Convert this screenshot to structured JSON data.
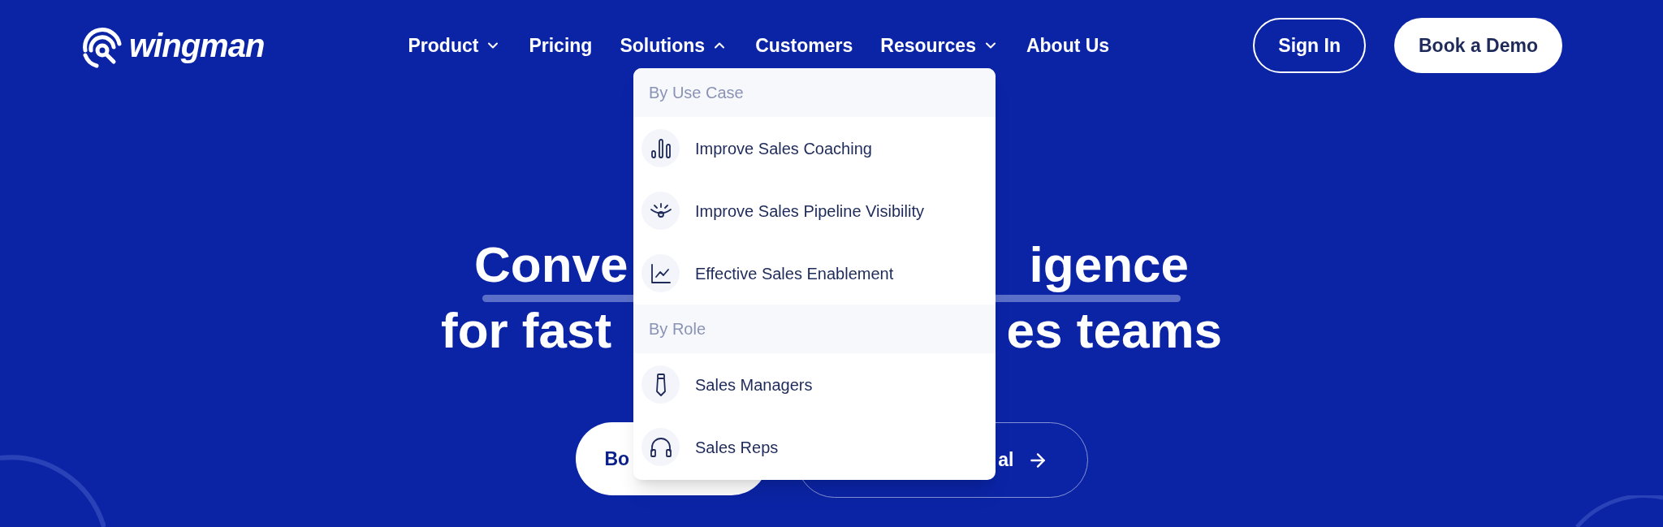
{
  "logo": {
    "text": "wingman"
  },
  "nav": [
    {
      "label": "Product",
      "expanded": false
    },
    {
      "label": "Pricing"
    },
    {
      "label": "Solutions",
      "expanded": true
    },
    {
      "label": "Customers"
    },
    {
      "label": "Resources",
      "expanded": false
    },
    {
      "label": "About Us"
    }
  ],
  "actions": [
    {
      "label": "Sign In",
      "kind": "outline"
    },
    {
      "label": "Book a Demo",
      "kind": "solid"
    }
  ],
  "dropdown": {
    "sections": [
      {
        "title": "By Use Case",
        "items": [
          {
            "label": "Improve Sales Coaching"
          },
          {
            "label": "Improve Sales Pipeline Visibility"
          },
          {
            "label": "Effective Sales Enablement"
          }
        ]
      },
      {
        "title": "By Role",
        "items": [
          {
            "label": "Sales Managers"
          },
          {
            "label": "Sales Reps"
          }
        ]
      }
    ]
  },
  "hero": {
    "lines": [
      {
        "left": "Conve",
        "right": "igence",
        "underlined": true
      },
      {
        "left": "for fast",
        "right": "es teams",
        "underlined": false
      }
    ],
    "buttons": [
      {
        "label": "Bo",
        "kind": "solid"
      },
      {
        "label": "al",
        "kind": "outline"
      }
    ]
  }
}
